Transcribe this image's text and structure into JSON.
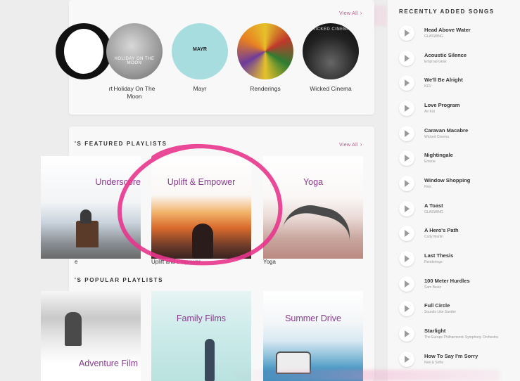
{
  "artists": {
    "view_all": "View All",
    "items": [
      {
        "name": "rt"
      },
      {
        "name": "Holiday On The Moon",
        "art_text": "HOLIDAY ON THE MOON"
      },
      {
        "name": "Mayr",
        "art_text": "MAYR"
      },
      {
        "name": "Renderings"
      },
      {
        "name": "Wicked Cinema",
        "art_text": "WICKED CINEMA"
      }
    ]
  },
  "featured": {
    "title": "'S FEATURED PLAYLISTS",
    "view_all": "View All",
    "items": [
      {
        "title": "Underscore",
        "caption": "e"
      },
      {
        "title": "Uplift & Empower",
        "caption": "Uplift and Empower"
      },
      {
        "title": "Yoga",
        "caption": "Yoga"
      }
    ]
  },
  "popular": {
    "title": "'S POPULAR PLAYLISTS",
    "items": [
      {
        "title": "Adventure Film"
      },
      {
        "title": "Family Films"
      },
      {
        "title": "Summer Drive"
      }
    ]
  },
  "sidebar": {
    "title": "RECENTLY ADDED SONGS",
    "songs": [
      {
        "title": "Head Above Water",
        "artist": "GLASWING"
      },
      {
        "title": "Acoustic Silence",
        "artist": "Emproal Glow"
      },
      {
        "title": "We'll Be Alright",
        "artist": "KEV"
      },
      {
        "title": "Love Program",
        "artist": "Air Kid"
      },
      {
        "title": "Caravan Macabre",
        "artist": "Wicked Cinema"
      },
      {
        "title": "Nightingale",
        "artist": "Emone"
      },
      {
        "title": "Window Shopping",
        "artist": "Ninn"
      },
      {
        "title": "A Toast",
        "artist": "GLASWING"
      },
      {
        "title": "A Hero's Path",
        "artist": "Cody Martin"
      },
      {
        "title": "Last Thesis",
        "artist": "Renderings"
      },
      {
        "title": "100 Meter Hurdles",
        "artist": "Sam Bevin"
      },
      {
        "title": "Full Circle",
        "artist": "Sounds Like Sander"
      },
      {
        "title": "Starlight",
        "artist": "The Europe Philharmonic Symphony Orchestra"
      },
      {
        "title": "How To Say I'm Sorry",
        "artist": "Noé & Sofía"
      }
    ]
  },
  "colors": {
    "accent": "#d24c8f",
    "highlight": "#e8358d",
    "title_purple": "#8a3a8e"
  }
}
